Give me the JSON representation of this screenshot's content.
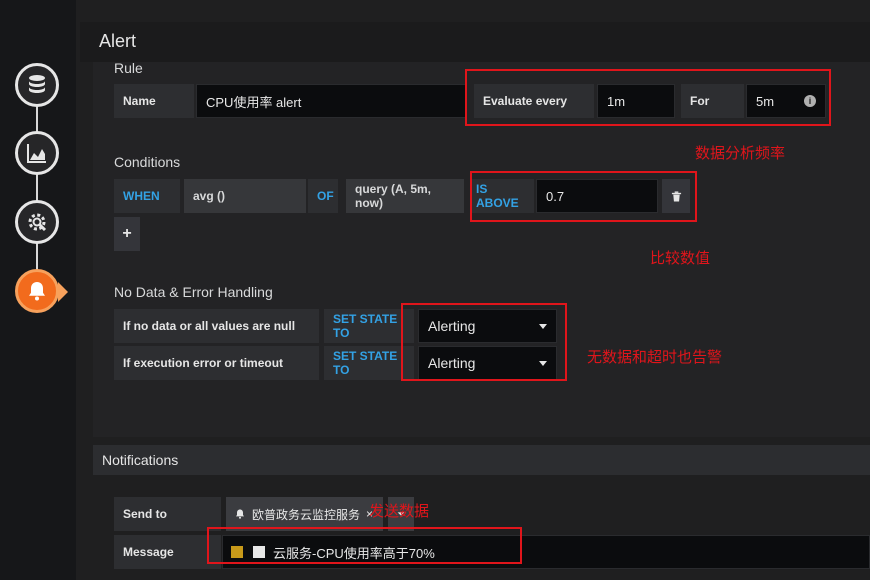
{
  "page": {
    "title": "Alert"
  },
  "rule": {
    "section_label": "Rule",
    "name_label": "Name",
    "name_value": "CPU使用率 alert",
    "evaluate_every_label": "Evaluate every",
    "evaluate_every_value": "1m",
    "for_label": "For",
    "for_value": "5m"
  },
  "conditions": {
    "section_label": "Conditions",
    "when_label": "WHEN",
    "reducer": "avg ()",
    "of_label": "OF",
    "query": "query (A, 5m, now)",
    "evaluator": "IS ABOVE",
    "threshold": "0.7",
    "add_label": "+"
  },
  "nodata": {
    "section_label": "No Data & Error Handling",
    "rows": [
      {
        "label": "If no data or all values are null",
        "action": "SET STATE TO",
        "state": "Alerting"
      },
      {
        "label": "If execution error or timeout",
        "action": "SET STATE TO",
        "state": "Alerting"
      }
    ]
  },
  "notifications": {
    "header": "Notifications",
    "send_to_label": "Send to",
    "channel": "欧普政务云监控服务",
    "channel_remove": "×",
    "message_label": "Message",
    "message_value": "云服务-CPU使用率高于70%"
  },
  "annotations": {
    "frequency": "数据分析频率",
    "compare": "比较数值",
    "nodata": "无数据和超时也告警",
    "send": "发送数据"
  },
  "colors": {
    "accent_blue": "#33a2e5",
    "annotation_red": "#e0151b",
    "active_step": "#f26b1d"
  },
  "icons": {
    "steps": [
      "database-icon",
      "chart-icon",
      "settings-gear-icon",
      "bell-icon"
    ],
    "info": "info-icon",
    "trash": "trash-icon",
    "channel": "bell-icon",
    "caret": "caret-down-icon"
  }
}
